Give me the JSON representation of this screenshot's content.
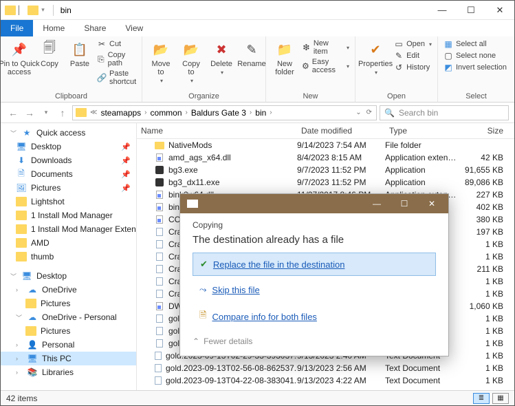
{
  "window": {
    "title": "bin",
    "controls": {
      "minimize": "—",
      "maximize": "☐",
      "close": "✕"
    }
  },
  "tabs": {
    "file": "File",
    "home": "Home",
    "share": "Share",
    "view": "View"
  },
  "ribbon": {
    "clipboard": {
      "label": "Clipboard",
      "pin": "Pin to Quick\naccess",
      "copy": "Copy",
      "paste": "Paste",
      "cut": "Cut",
      "copy_path": "Copy path",
      "paste_shortcut": "Paste shortcut"
    },
    "organize": {
      "label": "Organize",
      "move_to": "Move\nto",
      "copy_to": "Copy\nto",
      "delete": "Delete",
      "rename": "Rename"
    },
    "new": {
      "label": "New",
      "new_folder": "New\nfolder",
      "new_item": "New item",
      "easy_access": "Easy access"
    },
    "open": {
      "label": "Open",
      "properties": "Properties",
      "open": "Open",
      "edit": "Edit",
      "history": "History"
    },
    "select": {
      "label": "Select",
      "select_all": "Select all",
      "select_none": "Select none",
      "invert": "Invert selection"
    }
  },
  "breadcrumbs": [
    "steamapps",
    "common",
    "Baldurs Gate 3",
    "bin"
  ],
  "search_placeholder": "Search bin",
  "sidebar": {
    "quick_access": "Quick access",
    "items1": [
      "Desktop",
      "Downloads",
      "Documents",
      "Pictures",
      "Lightshot",
      "1 Install Mod Manager",
      "1 Install Mod Manager Exten",
      "AMD",
      "thumb"
    ],
    "desktop": "Desktop",
    "onedrive": "OneDrive",
    "pictures": "Pictures",
    "onedrive_personal": "OneDrive - Personal",
    "pictures2": "Pictures",
    "personal": "Personal",
    "this_pc": "This PC",
    "libraries": "Libraries"
  },
  "columns": {
    "name": "Name",
    "date": "Date modified",
    "type": "Type",
    "size": "Size"
  },
  "files": [
    {
      "icon": "folder",
      "name": "NativeMods",
      "date": "9/14/2023 7:54 AM",
      "type": "File folder",
      "size": ""
    },
    {
      "icon": "dll",
      "name": "amd_ags_x64.dll",
      "date": "8/4/2023 8:15 AM",
      "type": "Application exten…",
      "size": "42 KB"
    },
    {
      "icon": "exe",
      "name": "bg3.exe",
      "date": "9/7/2023 11:52 PM",
      "type": "Application",
      "size": "91,655 KB"
    },
    {
      "icon": "exe",
      "name": "bg3_dx11.exe",
      "date": "9/7/2023 11:52 PM",
      "type": "Application",
      "size": "89,086 KB"
    },
    {
      "icon": "dll",
      "name": "bink2w64.dll",
      "date": "11/27/2017 8:46 PM",
      "type": "Application exten…",
      "size": "227 KB"
    },
    {
      "icon": "dll",
      "name": "bink2w64",
      "date": "",
      "type": "",
      "size": "402 KB"
    },
    {
      "icon": "dll",
      "name": "CChroma",
      "date": "",
      "type": "",
      "size": "380 KB"
    },
    {
      "icon": "txt",
      "name": "CrashDur",
      "date": "",
      "type": "",
      "size": "197 KB"
    },
    {
      "icon": "txt",
      "name": "CrashDur",
      "date": "",
      "type": "",
      "size": "1 KB"
    },
    {
      "icon": "txt",
      "name": "CrashDur",
      "date": "",
      "type": "",
      "size": "1 KB"
    },
    {
      "icon": "txt",
      "name": "CrashDur",
      "date": "",
      "type": "",
      "size": "211 KB"
    },
    {
      "icon": "txt",
      "name": "CrashDur",
      "date": "",
      "type": "",
      "size": "1 KB"
    },
    {
      "icon": "txt",
      "name": "CrashDur",
      "date": "",
      "type": "",
      "size": "1 KB"
    },
    {
      "icon": "dll",
      "name": "DWrite.dl",
      "date": "",
      "type": "",
      "size": "1,060 KB"
    },
    {
      "icon": "txt",
      "name": "gold.2023",
      "date": "",
      "type": "",
      "size": "1 KB"
    },
    {
      "icon": "txt",
      "name": "gold.2023",
      "date": "",
      "type": "",
      "size": "1 KB"
    },
    {
      "icon": "txt",
      "name": "gold.2023",
      "date": "",
      "type": "",
      "size": "1 KB"
    },
    {
      "icon": "txt",
      "name": "gold.2023-09-13T02-29-33-393037.log",
      "date": "9/13/2023 2:40 AM",
      "type": "Text Document",
      "size": "1 KB"
    },
    {
      "icon": "txt",
      "name": "gold.2023-09-13T02-56-08-862537.log",
      "date": "9/13/2023 2:56 AM",
      "type": "Text Document",
      "size": "1 KB"
    },
    {
      "icon": "txt",
      "name": "gold.2023-09-13T04-22-08-383041.log",
      "date": "9/13/2023 4:22 AM",
      "type": "Text Document",
      "size": "1 KB"
    }
  ],
  "dialog": {
    "copying": "Copying",
    "heading": "The destination already has a file",
    "replace": "Replace the file in the destination",
    "skip": "Skip this file",
    "compare": "Compare info for both files",
    "fewer": "Fewer details"
  },
  "status": {
    "items": "42 items"
  }
}
